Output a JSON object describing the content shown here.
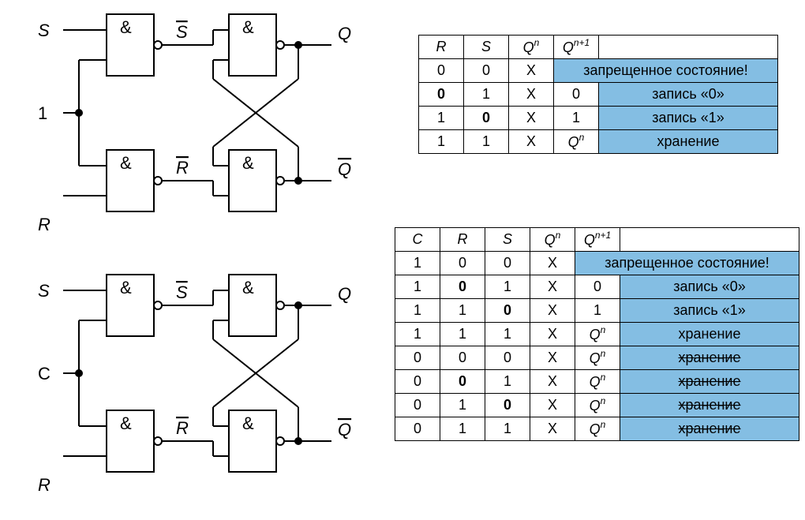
{
  "circuits": {
    "top": {
      "inputs": {
        "s": "S",
        "mid": "1",
        "r": "R"
      },
      "wires": {
        "sbar": "S̄",
        "rbar": "R̄"
      },
      "outputs": {
        "q": "Q",
        "qbar": "Q̄"
      },
      "gate_symbol": "&"
    },
    "bottom": {
      "inputs": {
        "s": "S",
        "mid": "C",
        "r": "R"
      },
      "wires": {
        "sbar": "S̄",
        "rbar": "R̄"
      },
      "outputs": {
        "q": "Q",
        "qbar": "Q̄"
      },
      "gate_symbol": "&"
    }
  },
  "table1": {
    "headers": [
      "R",
      "S",
      "Qⁿ",
      "Qⁿ⁺¹",
      ""
    ],
    "rows": [
      {
        "cells": [
          "0",
          "0",
          "X"
        ],
        "qnext": "",
        "desc": "запрещенное состояние!",
        "span": true
      },
      {
        "cells": [
          "0",
          "1",
          "X"
        ],
        "qnext": "0",
        "desc": "запись «0»",
        "bold_col": 0
      },
      {
        "cells": [
          "1",
          "0",
          "X"
        ],
        "qnext": "1",
        "desc": "запись «1»",
        "bold_col": 1
      },
      {
        "cells": [
          "1",
          "1",
          "X"
        ],
        "qnext": "Qⁿ",
        "desc": "хранение",
        "qn_it": true
      }
    ]
  },
  "table2": {
    "headers": [
      "C",
      "R",
      "S",
      "Qⁿ",
      "Qⁿ⁺¹",
      ""
    ],
    "rows": [
      {
        "cells": [
          "1",
          "0",
          "0",
          "X"
        ],
        "qnext": "",
        "desc": "запрещенное состояние!",
        "span": true
      },
      {
        "cells": [
          "1",
          "0",
          "1",
          "X"
        ],
        "qnext": "0",
        "desc": "запись «0»",
        "bold_col": 1
      },
      {
        "cells": [
          "1",
          "1",
          "0",
          "X"
        ],
        "qnext": "1",
        "desc": "запись «1»",
        "bold_col": 2
      },
      {
        "cells": [
          "1",
          "1",
          "1",
          "X"
        ],
        "qnext": "Qⁿ",
        "desc": "хранение",
        "qn_it": true
      },
      {
        "cells": [
          "0",
          "0",
          "0",
          "X"
        ],
        "qnext": "Qⁿ",
        "desc": "хранение",
        "qn_it": true,
        "strike": true
      },
      {
        "cells": [
          "0",
          "0",
          "1",
          "X"
        ],
        "qnext": "Qⁿ",
        "desc": "хранение",
        "qn_it": true,
        "strike": true,
        "bold_col": 1
      },
      {
        "cells": [
          "0",
          "1",
          "0",
          "X"
        ],
        "qnext": "Qⁿ",
        "desc": "хранение",
        "qn_it": true,
        "strike": true,
        "bold_col": 2
      },
      {
        "cells": [
          "0",
          "1",
          "1",
          "X"
        ],
        "qnext": "Qⁿ",
        "desc": "хранение",
        "qn_it": true,
        "strike": true
      }
    ]
  }
}
